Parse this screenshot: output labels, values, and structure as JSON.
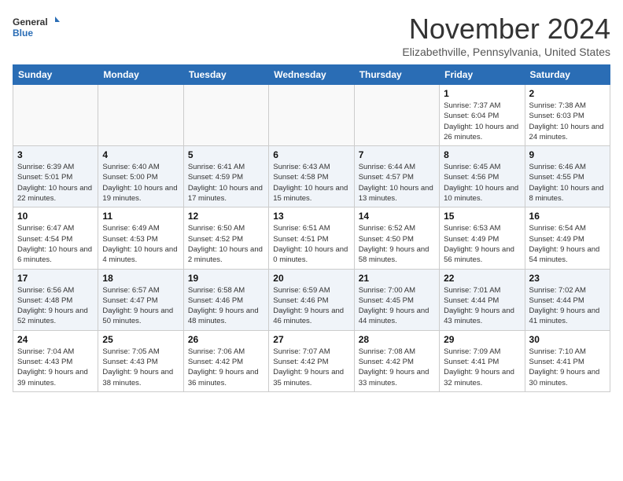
{
  "header": {
    "logo_general": "General",
    "logo_blue": "Blue",
    "month": "November 2024",
    "location": "Elizabethville, Pennsylvania, United States"
  },
  "weekdays": [
    "Sunday",
    "Monday",
    "Tuesday",
    "Wednesday",
    "Thursday",
    "Friday",
    "Saturday"
  ],
  "weeks": [
    [
      {
        "day": "",
        "info": ""
      },
      {
        "day": "",
        "info": ""
      },
      {
        "day": "",
        "info": ""
      },
      {
        "day": "",
        "info": ""
      },
      {
        "day": "",
        "info": ""
      },
      {
        "day": "1",
        "info": "Sunrise: 7:37 AM\nSunset: 6:04 PM\nDaylight: 10 hours and 26 minutes."
      },
      {
        "day": "2",
        "info": "Sunrise: 7:38 AM\nSunset: 6:03 PM\nDaylight: 10 hours and 24 minutes."
      }
    ],
    [
      {
        "day": "3",
        "info": "Sunrise: 6:39 AM\nSunset: 5:01 PM\nDaylight: 10 hours and 22 minutes."
      },
      {
        "day": "4",
        "info": "Sunrise: 6:40 AM\nSunset: 5:00 PM\nDaylight: 10 hours and 19 minutes."
      },
      {
        "day": "5",
        "info": "Sunrise: 6:41 AM\nSunset: 4:59 PM\nDaylight: 10 hours and 17 minutes."
      },
      {
        "day": "6",
        "info": "Sunrise: 6:43 AM\nSunset: 4:58 PM\nDaylight: 10 hours and 15 minutes."
      },
      {
        "day": "7",
        "info": "Sunrise: 6:44 AM\nSunset: 4:57 PM\nDaylight: 10 hours and 13 minutes."
      },
      {
        "day": "8",
        "info": "Sunrise: 6:45 AM\nSunset: 4:56 PM\nDaylight: 10 hours and 10 minutes."
      },
      {
        "day": "9",
        "info": "Sunrise: 6:46 AM\nSunset: 4:55 PM\nDaylight: 10 hours and 8 minutes."
      }
    ],
    [
      {
        "day": "10",
        "info": "Sunrise: 6:47 AM\nSunset: 4:54 PM\nDaylight: 10 hours and 6 minutes."
      },
      {
        "day": "11",
        "info": "Sunrise: 6:49 AM\nSunset: 4:53 PM\nDaylight: 10 hours and 4 minutes."
      },
      {
        "day": "12",
        "info": "Sunrise: 6:50 AM\nSunset: 4:52 PM\nDaylight: 10 hours and 2 minutes."
      },
      {
        "day": "13",
        "info": "Sunrise: 6:51 AM\nSunset: 4:51 PM\nDaylight: 10 hours and 0 minutes."
      },
      {
        "day": "14",
        "info": "Sunrise: 6:52 AM\nSunset: 4:50 PM\nDaylight: 9 hours and 58 minutes."
      },
      {
        "day": "15",
        "info": "Sunrise: 6:53 AM\nSunset: 4:49 PM\nDaylight: 9 hours and 56 minutes."
      },
      {
        "day": "16",
        "info": "Sunrise: 6:54 AM\nSunset: 4:49 PM\nDaylight: 9 hours and 54 minutes."
      }
    ],
    [
      {
        "day": "17",
        "info": "Sunrise: 6:56 AM\nSunset: 4:48 PM\nDaylight: 9 hours and 52 minutes."
      },
      {
        "day": "18",
        "info": "Sunrise: 6:57 AM\nSunset: 4:47 PM\nDaylight: 9 hours and 50 minutes."
      },
      {
        "day": "19",
        "info": "Sunrise: 6:58 AM\nSunset: 4:46 PM\nDaylight: 9 hours and 48 minutes."
      },
      {
        "day": "20",
        "info": "Sunrise: 6:59 AM\nSunset: 4:46 PM\nDaylight: 9 hours and 46 minutes."
      },
      {
        "day": "21",
        "info": "Sunrise: 7:00 AM\nSunset: 4:45 PM\nDaylight: 9 hours and 44 minutes."
      },
      {
        "day": "22",
        "info": "Sunrise: 7:01 AM\nSunset: 4:44 PM\nDaylight: 9 hours and 43 minutes."
      },
      {
        "day": "23",
        "info": "Sunrise: 7:02 AM\nSunset: 4:44 PM\nDaylight: 9 hours and 41 minutes."
      }
    ],
    [
      {
        "day": "24",
        "info": "Sunrise: 7:04 AM\nSunset: 4:43 PM\nDaylight: 9 hours and 39 minutes."
      },
      {
        "day": "25",
        "info": "Sunrise: 7:05 AM\nSunset: 4:43 PM\nDaylight: 9 hours and 38 minutes."
      },
      {
        "day": "26",
        "info": "Sunrise: 7:06 AM\nSunset: 4:42 PM\nDaylight: 9 hours and 36 minutes."
      },
      {
        "day": "27",
        "info": "Sunrise: 7:07 AM\nSunset: 4:42 PM\nDaylight: 9 hours and 35 minutes."
      },
      {
        "day": "28",
        "info": "Sunrise: 7:08 AM\nSunset: 4:42 PM\nDaylight: 9 hours and 33 minutes."
      },
      {
        "day": "29",
        "info": "Sunrise: 7:09 AM\nSunset: 4:41 PM\nDaylight: 9 hours and 32 minutes."
      },
      {
        "day": "30",
        "info": "Sunrise: 7:10 AM\nSunset: 4:41 PM\nDaylight: 9 hours and 30 minutes."
      }
    ]
  ]
}
